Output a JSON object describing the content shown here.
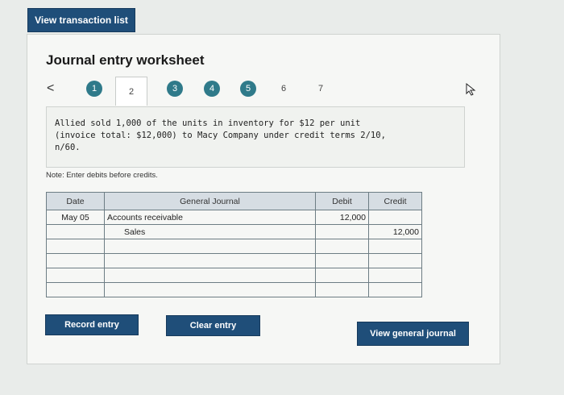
{
  "top_button": "View transaction list",
  "worksheet_title": "Journal entry worksheet",
  "steps": {
    "prev": "<",
    "items": [
      "1",
      "2",
      "3",
      "4",
      "5",
      "6",
      "7"
    ]
  },
  "description": "Allied sold 1,000 of the units in inventory for $12 per unit (invoice total: $12,000) to Macy Company under credit terms 2/10, n/60.",
  "note": "Note: Enter debits before credits.",
  "journal": {
    "headers": {
      "date": "Date",
      "account": "General Journal",
      "debit": "Debit",
      "credit": "Credit"
    },
    "rows": [
      {
        "date": "May 05",
        "account": "Accounts receivable",
        "debit": "12,000",
        "credit": ""
      },
      {
        "date": "",
        "account": "Sales",
        "debit": "",
        "credit": "12,000"
      },
      {
        "date": "",
        "account": "",
        "debit": "",
        "credit": ""
      },
      {
        "date": "",
        "account": "",
        "debit": "",
        "credit": ""
      },
      {
        "date": "",
        "account": "",
        "debit": "",
        "credit": ""
      },
      {
        "date": "",
        "account": "",
        "debit": "",
        "credit": ""
      }
    ]
  },
  "buttons": {
    "record": "Record entry",
    "clear": "Clear entry",
    "view_journal": "View general journal"
  },
  "colors": {
    "primary": "#1f4e79",
    "step_done": "#2f7a8a",
    "header_bg": "#d6dde3"
  }
}
